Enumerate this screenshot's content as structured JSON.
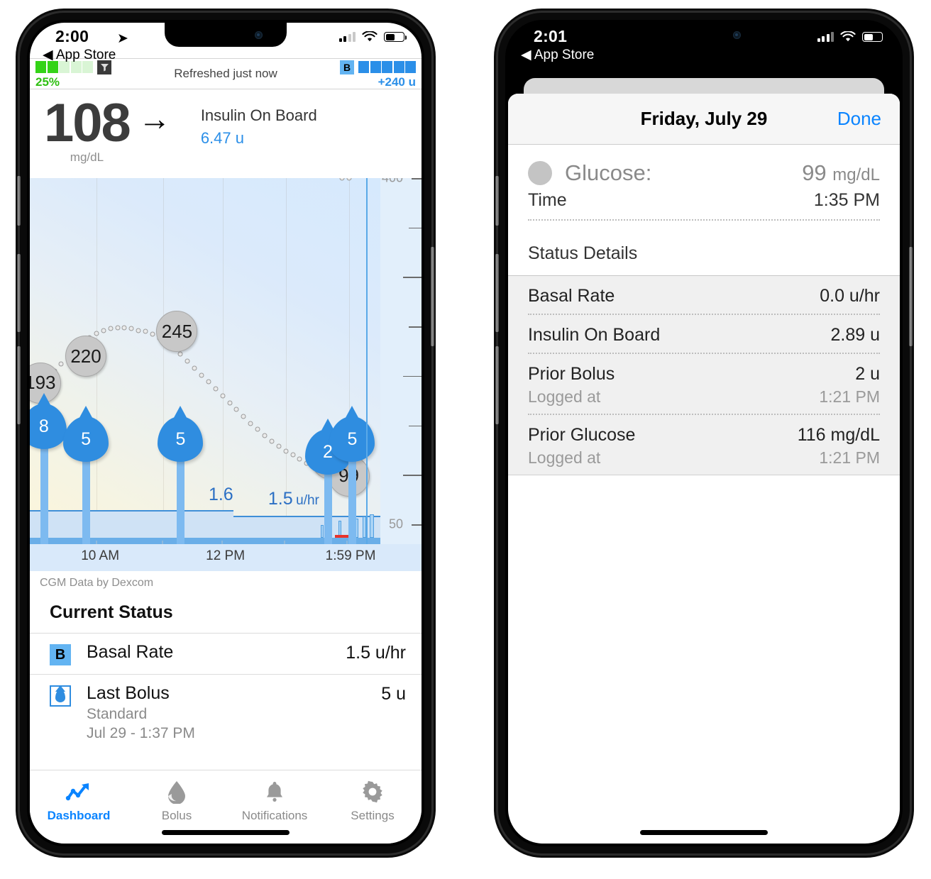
{
  "left_phone": {
    "status_bar": {
      "time": "2:00",
      "location_icon": "location-arrow-icon",
      "back_link": "◀ App Store",
      "cellular": "cellular-bars-icon",
      "wifi": "wifi-icon",
      "battery": "battery-icon"
    },
    "pump_strip": {
      "reservoir_percent": "25%",
      "reservoir_filled_segments": 2,
      "reservoir_total_segments": 5,
      "antenna_icon": "antenna-icon",
      "refresh_text": "Refreshed just now",
      "basal_badge": "B",
      "insulin_filled_segments": 5,
      "insulin_total_segments": 5,
      "insulin_text": "+240 u"
    },
    "glucose_header": {
      "value": "108",
      "unit": "mg/dL",
      "trend_arrow": "→",
      "iob_label": "Insulin On Board",
      "iob_value": "6.47 u"
    },
    "chart_footer_source": "CGM Data by Dexcom",
    "current_status": {
      "title": "Current Status",
      "rows": [
        {
          "icon": "basal-b-icon",
          "label": "Basal Rate",
          "sub": "",
          "value": "1.5 u/hr"
        },
        {
          "icon": "bolus-drop-icon",
          "label": "Last Bolus",
          "sub": "Standard",
          "sub2": "Jul 29 - 1:37 PM",
          "value": "5 u"
        }
      ]
    },
    "tabs": [
      {
        "label": "Dashboard",
        "icon": "chart-line-icon",
        "active": true
      },
      {
        "label": "Bolus",
        "icon": "drop-icon",
        "active": false
      },
      {
        "label": "Notifications",
        "icon": "bell-icon",
        "active": false
      },
      {
        "label": "Settings",
        "icon": "gear-icon",
        "active": false
      }
    ]
  },
  "right_phone": {
    "status_bar": {
      "time": "2:01",
      "back_link": "◀ App Store",
      "cellular": "cellular-bars-icon",
      "wifi": "wifi-icon",
      "battery": "battery-icon"
    },
    "sheet": {
      "title": "Friday, July 29",
      "done_label": "Done",
      "glucose_label": "Glucose:",
      "glucose_value": "99",
      "glucose_unit": "mg/dL",
      "time_label": "Time",
      "time_value": "1:35 PM",
      "details_title": "Status Details",
      "details": [
        {
          "label": "Basal Rate",
          "value": "0.0 u/hr"
        },
        {
          "label": "Insulin On Board",
          "value": "2.89 u"
        },
        {
          "label": "Prior Bolus",
          "value": "2 u",
          "sub_label": "Logged at",
          "sub_value": "1:21 PM"
        },
        {
          "label": "Prior Glucose",
          "value": "116 mg/dL",
          "sub_label": "Logged at",
          "sub_value": "1:21 PM"
        }
      ]
    }
  },
  "colors": {
    "accent_blue": "#0a84ff",
    "insulin_blue": "#2f8de0",
    "reservoir_green": "#34d317",
    "glucose_bubble_gray": "#c8c8c8"
  },
  "chart_data": {
    "type": "line",
    "title": "",
    "xlabel": "",
    "ylabel": "mg/dL",
    "ylim": [
      30,
      400
    ],
    "y_ticks": [
      400,
      50
    ],
    "y_tick_labels": [
      "400",
      "50"
    ],
    "grid": true,
    "legend": "none",
    "x_tick_labels": [
      "10 AM",
      "12 PM",
      "1:59 PM"
    ],
    "x_tick_positions_pct": [
      19,
      55,
      91
    ],
    "glucose_labeled_points": [
      {
        "label": "193",
        "x_pct": 3,
        "y_value": 193
      },
      {
        "label": "220",
        "x_pct": 16,
        "y_value": 220
      },
      {
        "label": "245",
        "x_pct": 42,
        "y_value": 245
      },
      {
        "label": "116",
        "x_pct": 86,
        "y_value": 116
      },
      {
        "label": "99",
        "x_pct": 91,
        "y_value": 99
      }
    ],
    "glucose_series_y": [
      193,
      198,
      205,
      212,
      220,
      228,
      234,
      239,
      243,
      246,
      248,
      249,
      249,
      248,
      246,
      245,
      242,
      238,
      233,
      228,
      222,
      215,
      208,
      201,
      194,
      187,
      180,
      173,
      166,
      159,
      152,
      146,
      140,
      134,
      129,
      124,
      120,
      116,
      112,
      108,
      104,
      101,
      99
    ],
    "glucose_series_x_pct": [
      3,
      5,
      7,
      9,
      11,
      13,
      15,
      17,
      19,
      21,
      23,
      25,
      27,
      29,
      31,
      33,
      35,
      37,
      39,
      41,
      43,
      45,
      47,
      49,
      51,
      53,
      55,
      57,
      59,
      61,
      63,
      65,
      67,
      69,
      71,
      73,
      75,
      77,
      79,
      81,
      83,
      85,
      87,
      89,
      91
    ],
    "basal_segments": [
      {
        "label": "1.6",
        "x_start_pct": 3,
        "x_end_pct": 57,
        "rate": 1.6
      },
      {
        "label": "1.5 u/hr",
        "x_start_pct": 58,
        "x_end_pct": 96,
        "rate": 1.5
      }
    ],
    "bolus_markers": [
      {
        "label": "8",
        "x_pct": 4,
        "units": 8
      },
      {
        "label": "5",
        "x_pct": 16,
        "units": 5
      },
      {
        "label": "5",
        "x_pct": 43,
        "units": 5
      },
      {
        "label": "2",
        "x_pct": 85,
        "units": 2
      },
      {
        "label": "5",
        "x_pct": 92,
        "units": 5
      }
    ],
    "now_marker_x_pct": 96,
    "now_label": "1:59 PM"
  }
}
